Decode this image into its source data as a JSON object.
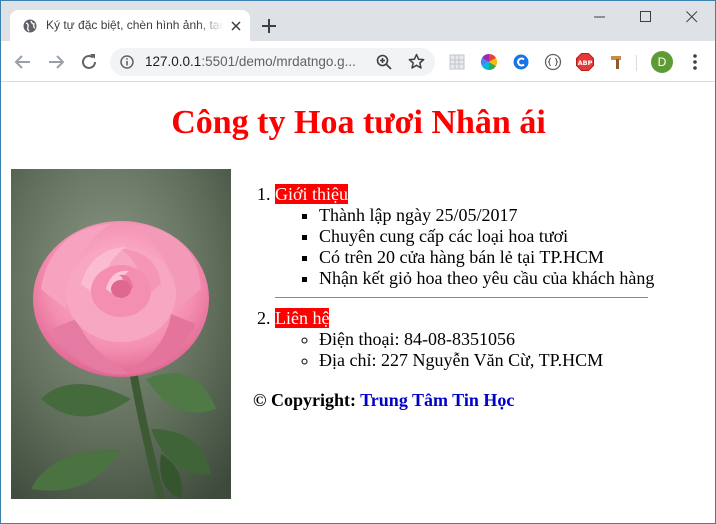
{
  "browser": {
    "tab_title": "Ký tự đặc biệt, chèn hình ảnh, tạo",
    "url_host": "127.0.0.1",
    "url_path": ":5501/demo/mrdatngo.g...",
    "profile_initial": "D"
  },
  "page": {
    "heading": "Công ty Hoa tươi Nhân ái",
    "image_alt": "pink-rose",
    "sections": [
      {
        "label": "Giới thiệu",
        "items": [
          "Thành lập ngày 25/05/2017",
          "Chuyên cung cấp các loại hoa tươi",
          "Có trên 20 cửa hàng bán lẻ tại TP.HCM",
          "Nhận kết giỏ hoa theo yêu cầu của khách hàng"
        ]
      },
      {
        "label": "Liên hệ",
        "items": [
          "Điện thoại: 84-08-8351056",
          "Địa chỉ: 227 Nguyễn Văn Cừ, TP.HCM"
        ]
      }
    ],
    "copyright_prefix": "© Copyright:",
    "copyright_org": "Trung Tâm Tin Học"
  },
  "colors": {
    "heading": "#ff0000",
    "label_bg": "#ff0000",
    "link": "#0000cc",
    "chrome_bg": "#dee1e6"
  }
}
